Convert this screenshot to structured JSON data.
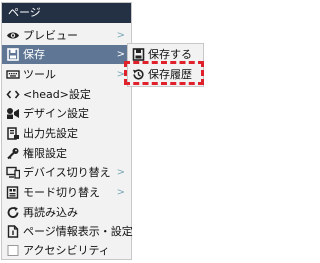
{
  "menu": {
    "title": "ページ",
    "items": [
      {
        "label": "プレビュー",
        "icon": "eye-icon",
        "has_submenu": true
      },
      {
        "label": "保存",
        "icon": "save-icon",
        "has_submenu": true,
        "active": true
      },
      {
        "label": "ツール",
        "icon": "keyboard-icon",
        "has_submenu": true
      },
      {
        "label": "<head>設定",
        "icon": "code-icon",
        "has_submenu": false
      },
      {
        "label": "デザイン設定",
        "icon": "design-icon",
        "has_submenu": false
      },
      {
        "label": "出力先設定",
        "icon": "output-icon",
        "has_submenu": false
      },
      {
        "label": "権限設定",
        "icon": "key-icon",
        "has_submenu": false
      },
      {
        "label": "デバイス切り替え",
        "icon": "devices-icon",
        "has_submenu": true
      },
      {
        "label": "モード切り替え",
        "icon": "mode-icon",
        "has_submenu": true
      },
      {
        "label": "再読み込み",
        "icon": "refresh-icon",
        "has_submenu": false
      },
      {
        "label": "ページ情報表示・設定",
        "icon": "info-icon",
        "has_submenu": false
      },
      {
        "label": "アクセシビリティ",
        "icon": "checkbox-icon",
        "has_submenu": false
      }
    ],
    "arrow": ">"
  },
  "submenu": {
    "items": [
      {
        "label": "保存する",
        "icon": "save-icon"
      },
      {
        "label": "保存履歴",
        "icon": "history-icon"
      }
    ]
  },
  "colors": {
    "header_bg": "#243043",
    "active_bg": "#5f7794",
    "menu_bg": "#f2f2f2",
    "highlight": "#e0202a"
  }
}
